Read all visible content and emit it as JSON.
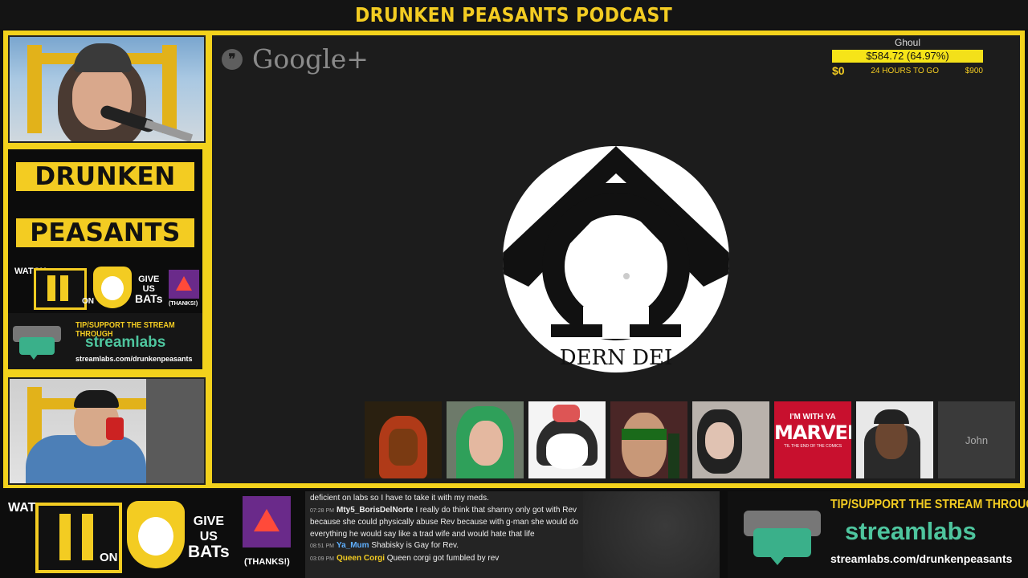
{
  "header": {
    "title": "DRUNKEN PEASANTS PODCAST"
  },
  "brand": {
    "word1": "DRUNKEN",
    "word2": "PEASANTS",
    "watch_label": "WATCH",
    "on_label": "ON",
    "give_label": "GIVE",
    "us_label": "US",
    "bats_label": "BATs",
    "thanks_label": "(THANKS!)",
    "tip_heading": "TIP/SUPPORT THE STREAM THROUGH",
    "streamlabs_logo": "streamlabs",
    "streamlabs_url": "streamlabs.com/drunkenpeasants"
  },
  "stage": {
    "platform_name": "Google+",
    "avatar_caption": "DERN DEI",
    "goal": {
      "name": "Ghoul",
      "amount": "$584.72 (64.97%)",
      "progress": 0.6497,
      "min": "$0",
      "time_left": "24 HOURS TO GO",
      "max": "$900"
    },
    "thumbnails": [
      {
        "kind": "cartoon-lion"
      },
      {
        "kind": "woman-green-hair"
      },
      {
        "kind": "anime-girl"
      },
      {
        "kind": "masked-man"
      },
      {
        "kind": "woman-dark-hair"
      },
      {
        "kind": "marvel-text",
        "line1": "I'M WITH YA",
        "line2": "MARVEL",
        "line3": "'TIL THE END OF THE COMICS"
      },
      {
        "kind": "man-cap"
      },
      {
        "kind": "name-tile",
        "name": "John"
      }
    ]
  },
  "bottom": {
    "watch_label": "WATCH",
    "on_label": "ON",
    "give_label": "GIVE",
    "us_label": "US",
    "bats_label": "BATs",
    "thanks_label": "(THANKS!)",
    "tip_heading": "TIP/SUPPORT THE STREAM THROUGH",
    "streamlabs_logo": "streamlabs",
    "streamlabs_url": "streamlabs.com/drunkenpeasants"
  },
  "chat": {
    "messages": [
      {
        "time": "",
        "user": "",
        "color": "#ffffff",
        "text": "deficient on labs so I have to take it with my meds."
      },
      {
        "time": "07:28 PM",
        "user": "Mty5_BorisDelNorte",
        "color": "#ffffff",
        "text": "I really do think that shanny only got with Rev because she could physically abuse Rev because with g-man she would do everything he would say like a trad wife and would hate that life"
      },
      {
        "time": "08:51 PM",
        "user": "Ya_Mum",
        "color": "#5fb0ff",
        "text": "Shabisky is Gay for Rev."
      },
      {
        "time": "03:09 PM",
        "user": "Queen Corgi",
        "color": "#f3cc22",
        "text": "Queen corgi got fumbled by rev"
      }
    ]
  },
  "colors": {
    "accent": "#f3cc22",
    "frame": "#f3d21c",
    "stage": "#1c1c1c",
    "bat_purple": "#6a2a8a"
  }
}
